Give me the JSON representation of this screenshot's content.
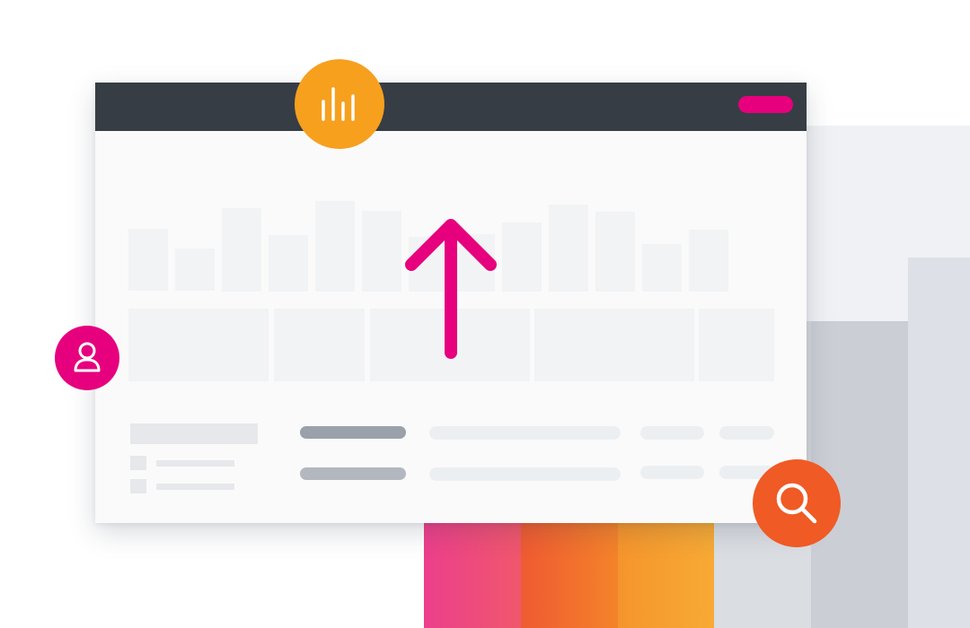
{
  "colors": {
    "titlebar": "#363d45",
    "accent_pink": "#e6007e",
    "accent_orange": "#f6a01e",
    "accent_red_orange": "#f05a24",
    "placeholder": "#f2f3f5"
  },
  "badges": {
    "chart": {
      "icon": "bar-chart-icon",
      "color": "#f6a01e"
    },
    "user": {
      "icon": "user-icon",
      "color": "#e6007e"
    },
    "search": {
      "icon": "search-icon",
      "color": "#f05a24"
    }
  },
  "titlebar": {
    "action_icon": "pill-button",
    "action_color": "#e6007e"
  },
  "arrow": {
    "icon": "up-arrow-icon",
    "color": "#e6007e"
  }
}
